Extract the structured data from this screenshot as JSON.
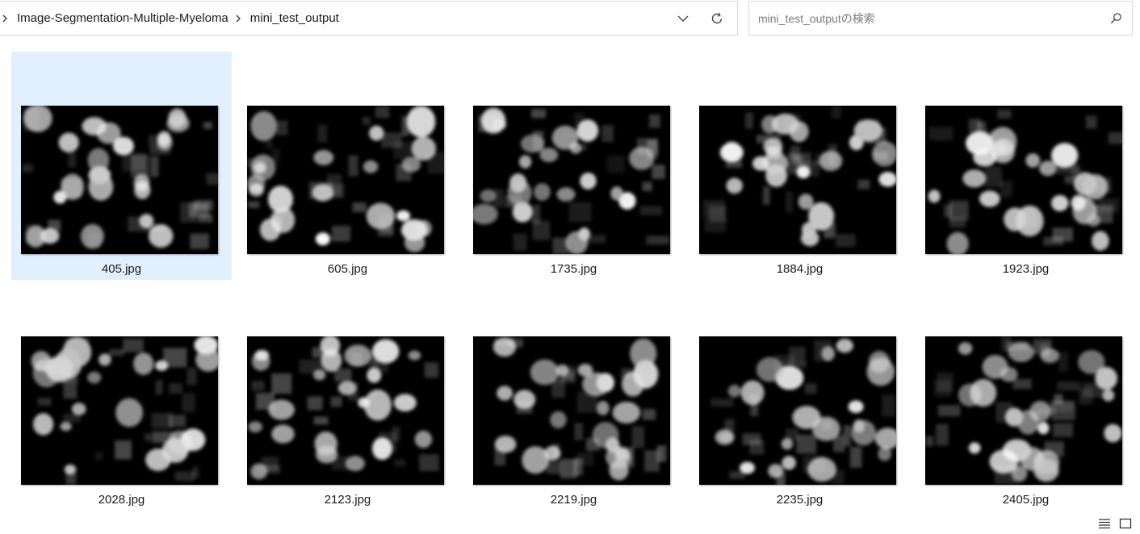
{
  "address_bar": {
    "breadcrumbs": [
      "Image-Segmentation-Multiple-Myeloma",
      "mini_test_output"
    ],
    "dropdown_icon": "chevron-down-icon",
    "refresh_icon": "refresh-icon"
  },
  "search": {
    "placeholder": "mini_test_outputの検索",
    "icon": "search-icon"
  },
  "files": [
    {
      "name": "405.jpg",
      "selected": true
    },
    {
      "name": "605.jpg",
      "selected": false
    },
    {
      "name": "1735.jpg",
      "selected": false
    },
    {
      "name": "1884.jpg",
      "selected": false
    },
    {
      "name": "1923.jpg",
      "selected": false
    },
    {
      "name": "2028.jpg",
      "selected": false
    },
    {
      "name": "2123.jpg",
      "selected": false
    },
    {
      "name": "2219.jpg",
      "selected": false
    },
    {
      "name": "2235.jpg",
      "selected": false
    },
    {
      "name": "2405.jpg",
      "selected": false
    }
  ],
  "view_toggles": [
    "details-view-icon",
    "large-icons-view-icon"
  ],
  "colors": {
    "selection": "#e1efff",
    "border": "#d9d9d9"
  }
}
